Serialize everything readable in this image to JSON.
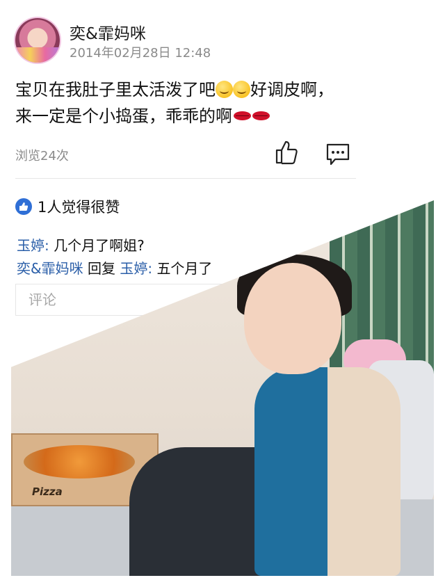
{
  "post": {
    "author_name": "奕&霏妈咪",
    "timestamp": "2014年02月28日 12:48",
    "text_line1_prefix": "宝贝在我肚子里太活泼了吧",
    "text_line1_suffix": "好调皮啊，",
    "text_line2": "来一定是个小捣蛋，乖乖的啊",
    "views": "浏览24次"
  },
  "icons": {
    "avatar": "avatar-photo",
    "like": "thumbs-up-icon",
    "comment": "comment-bubble-icon",
    "likes_badge": "thumbs-up-circle-icon",
    "emoji_smile": "smiling-face-emoji",
    "emoji_lips": "lips-emoji"
  },
  "likes": {
    "text": "1人觉得很赞",
    "badge_color": "#2f6fd6"
  },
  "comments": [
    {
      "user": "玉婷",
      "separator": ": ",
      "text": "几个月了啊姐?"
    },
    {
      "user": "奕&霏妈咪",
      "reply_word": " 回复 ",
      "reply_to": "玉婷",
      "separator": ": ",
      "text": "五个月了"
    }
  ],
  "comment_input": {
    "placeholder": "评论"
  },
  "photo": {
    "box_label": "Pizza"
  },
  "colors": {
    "username_link": "#2a5ea8",
    "meta_gray": "#8a8a8a"
  }
}
